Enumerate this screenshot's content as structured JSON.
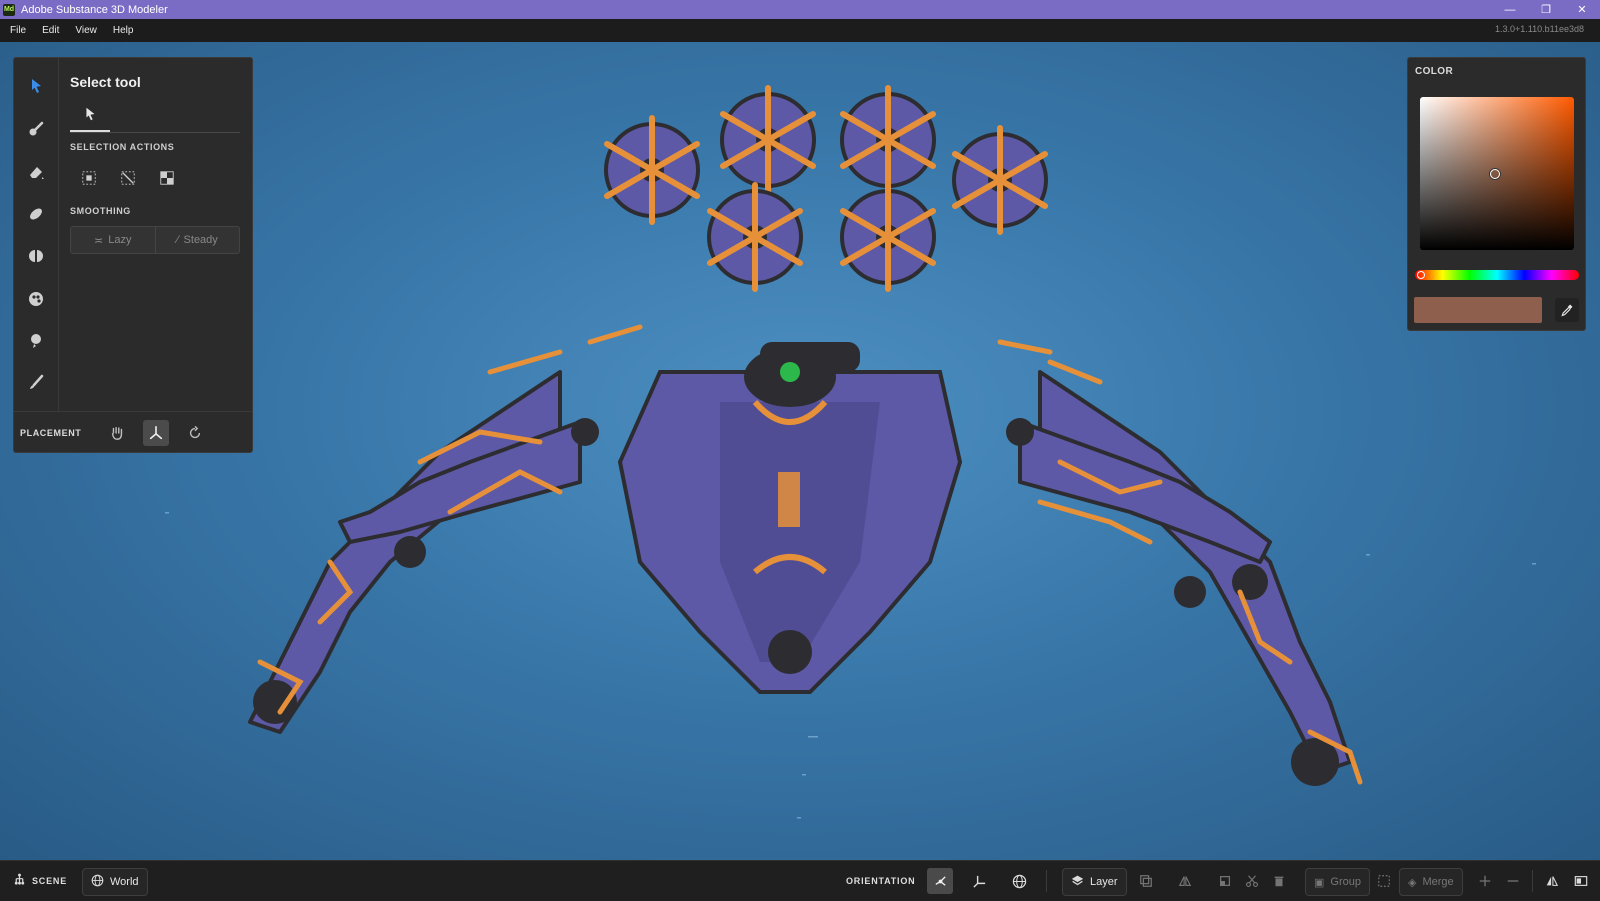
{
  "window": {
    "title": "Adobe Substance 3D Modeler",
    "app_badge": "Md",
    "version": "1.3.0+1.110.b11ee3d8",
    "controls": [
      "minimize-icon",
      "restore-icon",
      "close-icon"
    ]
  },
  "menu": {
    "items": [
      "File",
      "Edit",
      "View",
      "Help"
    ]
  },
  "tool_panel": {
    "tools": [
      "select-icon",
      "clay-brush-icon",
      "erase-icon",
      "smooth-brush-icon",
      "symmetry-icon",
      "paint-icon",
      "stamp-icon",
      "draw-brush-icon"
    ],
    "active_tool": "select-icon",
    "title": "Select tool",
    "selection_actions_label": "SELECTION ACTIONS",
    "selection_actions": [
      "select-all-icon",
      "deselect-icon",
      "invert-selection-icon"
    ],
    "smoothing_label": "SMOOTHING",
    "smoothing_options": [
      "Lazy",
      "Steady"
    ],
    "placement_label": "PLACEMENT",
    "placement_options": [
      "hand-icon",
      "gizmo-icon",
      "rotate-icon"
    ],
    "placement_active": "gizmo-icon"
  },
  "color_panel": {
    "title": "COLOR",
    "base_hue_color": "#ff5a00",
    "current_color": "#8d5f4c"
  },
  "bottom_bar": {
    "scene_label": "SCENE",
    "world_label": "World",
    "orientation_label": "ORIENTATION",
    "layer_label": "Layer",
    "group_label": "Group",
    "merge_label": "Merge"
  },
  "colors": {
    "titlebar": "#7a6cc4",
    "accent_blue": "#3a8eea",
    "viewport_bg": "#3876a8",
    "model_purple": "#5e59a6",
    "model_orange": "#e6913a",
    "model_dark": "#2d2d31"
  }
}
